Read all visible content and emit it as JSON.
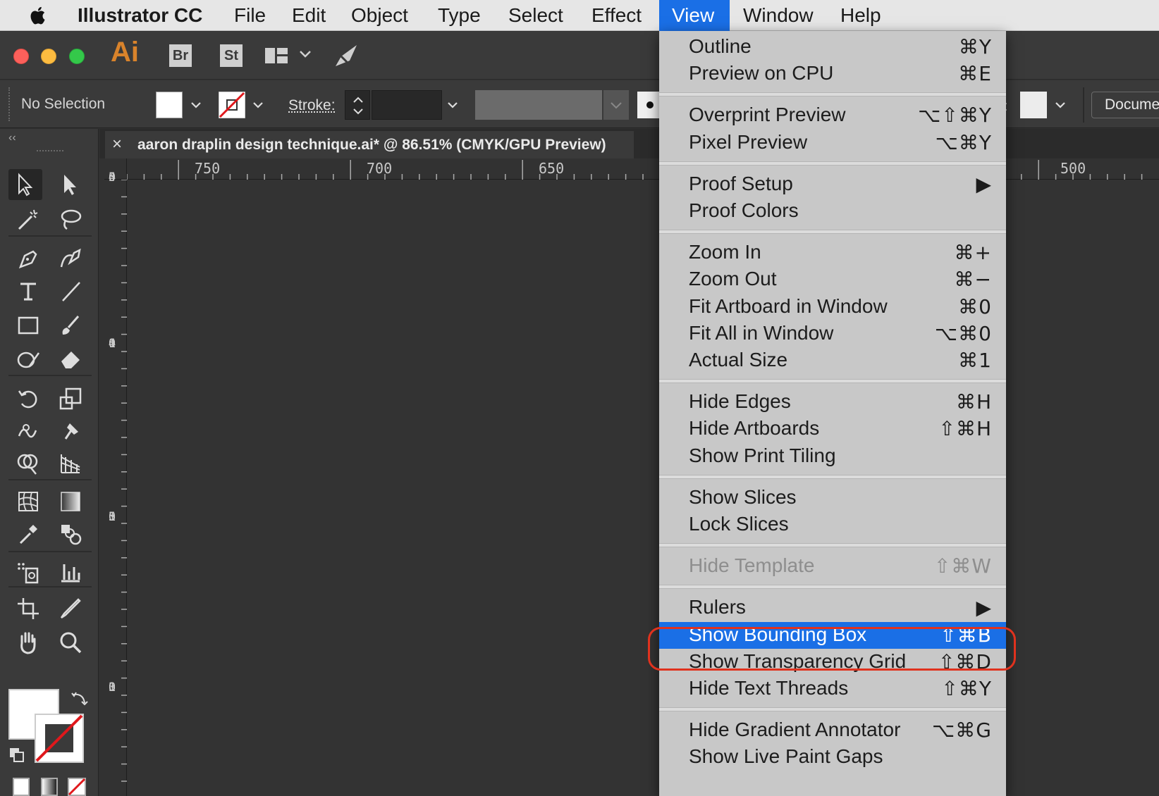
{
  "menubar": {
    "app_name": "Illustrator CC",
    "items": [
      "File",
      "Edit",
      "Object",
      "Type",
      "Select",
      "Effect",
      "View",
      "Window",
      "Help"
    ],
    "active": "View"
  },
  "app": {
    "logo": "Ai",
    "bridge_label": "Br",
    "stock_label": "St"
  },
  "control_bar": {
    "selection_status": "No Selection",
    "stroke_label": "Stroke:",
    "document_button": "Docume",
    "partial_label": ":"
  },
  "document": {
    "tab_close": "×",
    "tab_title": "aaron draplin design technique.ai* @ 86.51% (CMYK/GPU Preview)"
  },
  "rulers": {
    "horizontal": [
      "750",
      "700",
      "650",
      "500"
    ],
    "vertical": [
      [
        "4",
        "5",
        "0"
      ],
      [
        "1",
        "4",
        "0",
        "0"
      ],
      [
        "1",
        "3",
        "5",
        "0"
      ],
      [
        "1",
        "3",
        "0",
        "0"
      ]
    ]
  },
  "view_menu": {
    "groups": [
      [
        {
          "label": "Outline",
          "shortcut": "⌘Y"
        },
        {
          "label": "Preview on CPU",
          "shortcut": "⌘E"
        }
      ],
      [
        {
          "label": "Overprint Preview",
          "shortcut": "⌥⇧⌘Y"
        },
        {
          "label": "Pixel Preview",
          "shortcut": "⌥⌘Y"
        }
      ],
      [
        {
          "label": "Proof Setup",
          "shortcut": "▶"
        },
        {
          "label": "Proof Colors",
          "shortcut": ""
        }
      ],
      [
        {
          "label": "Zoom In",
          "shortcut": "⌘+"
        },
        {
          "label": "Zoom Out",
          "shortcut": "⌘−"
        },
        {
          "label": "Fit Artboard in Window",
          "shortcut": "⌘0"
        },
        {
          "label": "Fit All in Window",
          "shortcut": "⌥⌘0"
        },
        {
          "label": "Actual Size",
          "shortcut": "⌘1"
        }
      ],
      [
        {
          "label": "Hide Edges",
          "shortcut": "⌘H"
        },
        {
          "label": "Hide Artboards",
          "shortcut": "⇧⌘H"
        },
        {
          "label": "Show Print Tiling",
          "shortcut": ""
        }
      ],
      [
        {
          "label": "Show Slices",
          "shortcut": ""
        },
        {
          "label": "Lock Slices",
          "shortcut": ""
        }
      ],
      [
        {
          "label": "Hide Template",
          "shortcut": "⇧⌘W",
          "disabled": true
        }
      ],
      [
        {
          "label": "Rulers",
          "shortcut": "▶"
        },
        {
          "label": "Show Bounding Box",
          "shortcut": "⇧⌘B",
          "highlighted": true
        },
        {
          "label": "Show Transparency Grid",
          "shortcut": "⇧⌘D"
        },
        {
          "label": "Hide Text Threads",
          "shortcut": "⇧⌘Y"
        }
      ],
      [
        {
          "label": "Hide Gradient Annotator",
          "shortcut": "⌥⌘G"
        },
        {
          "label": "Show Live Paint Gaps",
          "shortcut": ""
        }
      ]
    ]
  },
  "colors": {
    "accent": "#1a6fe6",
    "callout": "#e0321e",
    "logo": "#d9832b"
  }
}
